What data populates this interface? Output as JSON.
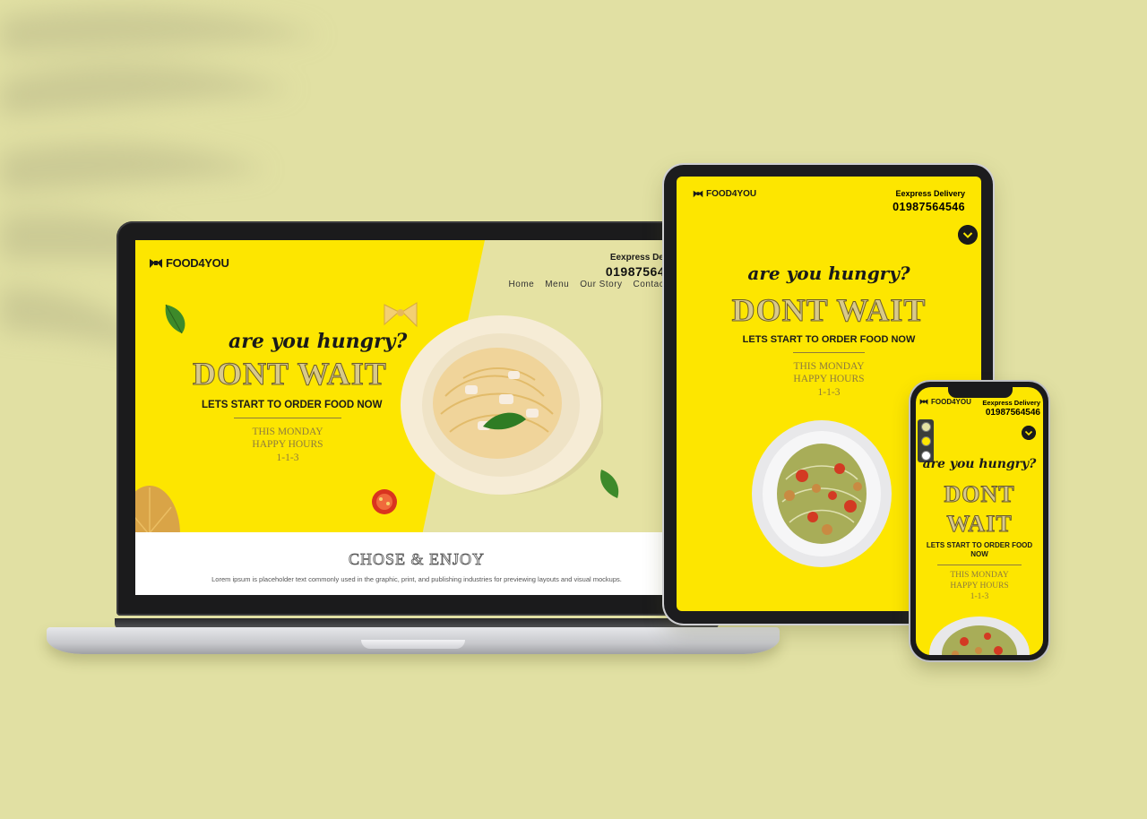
{
  "brand": {
    "name": "FOOD4YOU"
  },
  "header": {
    "delivery_label": "Eexpress Delivery",
    "phone": "01987564546"
  },
  "nav": {
    "items": [
      {
        "label": "Home"
      },
      {
        "label": "Menu"
      },
      {
        "label": "Our Story"
      },
      {
        "label": "Contact Us"
      }
    ]
  },
  "hero": {
    "tagline": "are you hungry?",
    "headline": "DONT WAIT",
    "headline_line1": "DONT",
    "headline_line2": "WAIT",
    "subheadline": "LETS START TO ORDER FOOD NOW",
    "promo_line1": "THIS MONDAY",
    "promo_line2": "HAPPY HOURS",
    "promo_line3": "1-1-3"
  },
  "section": {
    "title": "CHOSE & ENJOY",
    "description": "Lorem ipsum is placeholder text commonly used in the graphic, print, and publishing industries for previewing layouts and visual mockups."
  },
  "theme": {
    "accent": "#fde600",
    "background": "#e1e0a3",
    "secondary": "#e5e2a3",
    "dark": "#1a1a1a",
    "swatches": [
      "#e5e2a3",
      "#fde600",
      "#ffffff"
    ]
  },
  "icons": [
    "logo-mark-icon",
    "chevron-down-icon",
    "theme-swatch-icon"
  ]
}
